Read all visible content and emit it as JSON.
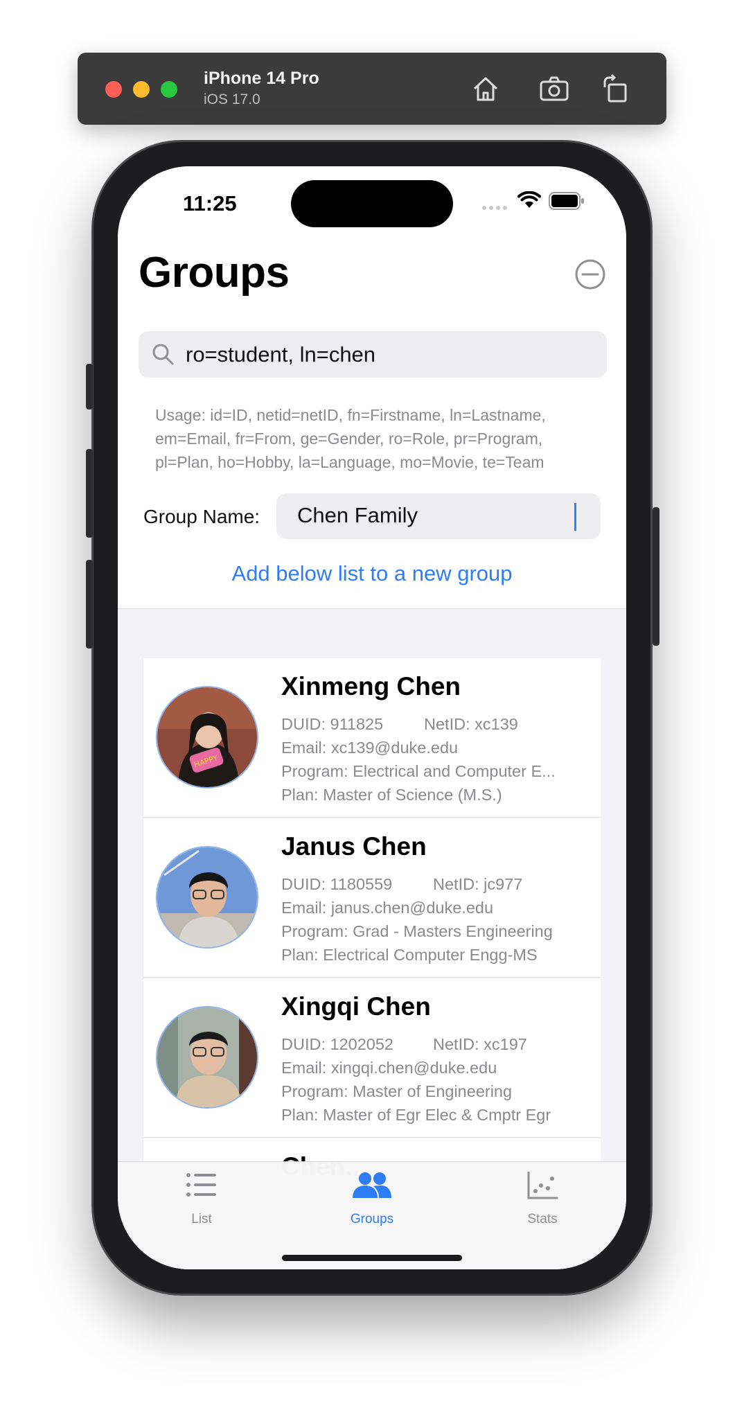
{
  "simulator": {
    "device_name": "iPhone 14 Pro",
    "os_version": "iOS 17.0",
    "buttons": [
      "home-icon",
      "screenshot-icon",
      "rotate-icon"
    ]
  },
  "status_bar": {
    "time": "11:25",
    "icons": [
      "signal-icon",
      "wifi-icon",
      "battery-icon"
    ]
  },
  "header": {
    "title": "Groups",
    "action_icon": "minus-circle-icon"
  },
  "search": {
    "query": "ro=student, ln=chen",
    "icon": "search-icon"
  },
  "usage_text": "Usage: id=ID, netid=netID, fn=Firstname, ln=Lastname, em=Email, fr=From, ge=Gender, ro=Role, pr=Program, pl=Plan, ho=Hobby, la=Language, mo=Movie, te=Team",
  "group_form": {
    "label": "Group Name:",
    "value": "Chen Family",
    "add_button": "Add below list to a new group"
  },
  "people": [
    {
      "name": "Xinmeng Chen",
      "duid": "DUID: 911825",
      "netid": "NetID: xc139",
      "email": "Email: xc139@duke.edu",
      "program": "Program: Electrical and Computer E...",
      "plan": "Plan: Master of Science (M.S.)"
    },
    {
      "name": "Janus Chen",
      "duid": "DUID: 1180559",
      "netid": "NetID: jc977",
      "email": "Email: janus.chen@duke.edu",
      "program": "Program: Grad - Masters Engineering",
      "plan": "Plan: Electrical Computer Engg-MS"
    },
    {
      "name": "Xingqi Chen",
      "duid": "DUID: 1202052",
      "netid": "NetID: xc197",
      "email": "Email: xingqi.chen@duke.edu",
      "program": "Program: Master of Engineering",
      "plan": "Plan: Master of Egr Elec & Cmptr Egr"
    },
    {
      "name": "Chen..."
    }
  ],
  "tabs": [
    {
      "label": "List",
      "icon": "list-icon",
      "active": false
    },
    {
      "label": "Groups",
      "icon": "people-icon",
      "active": true
    },
    {
      "label": "Stats",
      "icon": "scatter-chart-icon",
      "active": false
    }
  ],
  "colors": {
    "accent": "#2f7df6",
    "secondary_text": "#8a8a8e",
    "background": "#f2f2f7"
  }
}
